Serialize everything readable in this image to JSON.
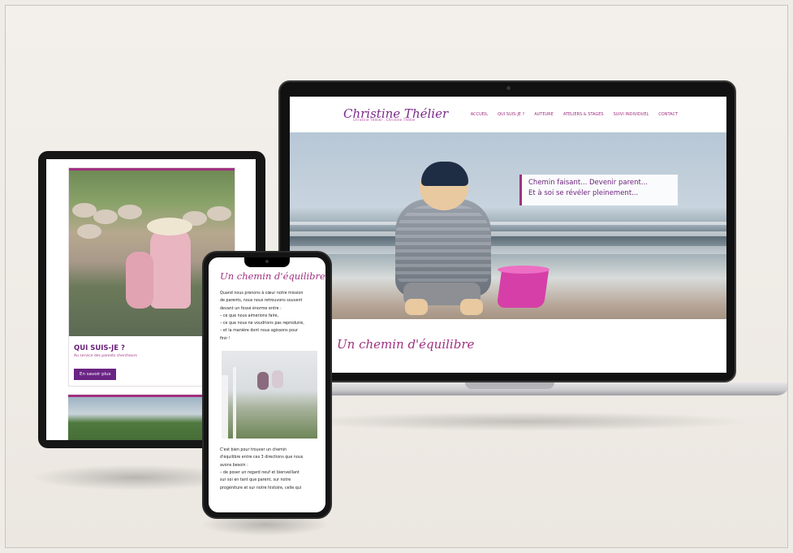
{
  "laptop": {
    "site": {
      "logo_name": "Christine Thélier",
      "logo_sub": "Christine Thélier . Christine Thélier",
      "nav": [
        "ACCUEIL",
        "QUI SUIS-JE ?",
        "AUTEURE",
        "ATELIERS & STAGES",
        "SUIVI INDIVIDUEL",
        "CONTACT"
      ],
      "hero_quote_line1": "Chemin faisant... Devenir parent...",
      "hero_quote_line2": "Et à soi se révéler pleinement...",
      "section_title": "Un chemin d'équilibre"
    }
  },
  "tablet": {
    "card_title": "QUI SUIS-JE ?",
    "card_subtitle": "Au service des parents chercheurs",
    "button_label": "En savoir plus"
  },
  "phone": {
    "title": "Un chemin d'équilibre",
    "paragraph1": [
      "Quand nous prenons à cœur notre mission",
      "de parents, nous nous retrouvons souvent",
      "devant un fossé énorme entre :",
      "– ce que nous aimerions faire,",
      "– ce que nous ne voudrions pas reproduire,",
      "– et la manière dont nous agissons pour",
      "finir !"
    ],
    "paragraph2": [
      "C'est bien pour trouver un chemin",
      "d'équilibre entre ces 3 directions que nous",
      "avons besoin :",
      "– de poser un regard neuf et bienveillant",
      "sur soi en tant que parent, sur notre",
      "progéniture et sur notre histoire, celle qui"
    ]
  },
  "colors": {
    "accent": "#a0307f",
    "purple": "#6a1f7a",
    "button": "#6a2483",
    "bucket_pink": "#d63fa8"
  }
}
